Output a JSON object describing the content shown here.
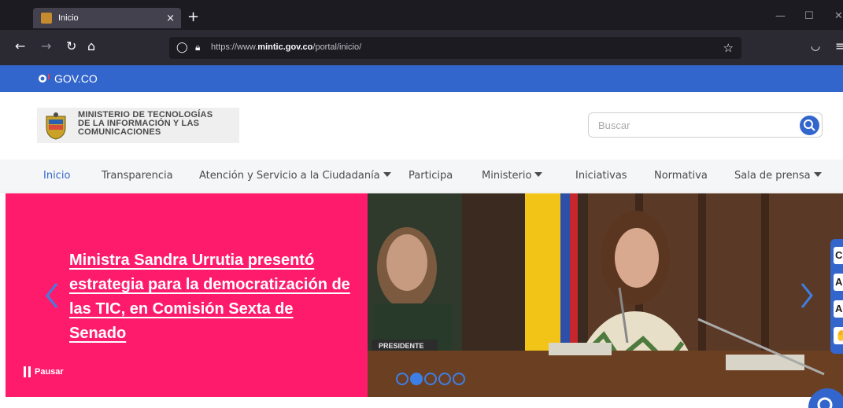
{
  "browser": {
    "tab_title": "Inicio",
    "tab_close": "×",
    "new_tab": "+",
    "url_prefix": "https://www.",
    "url_domain": "mintic.gov.co",
    "url_path": "/portal/inicio/"
  },
  "gov_bar": {
    "label": "GOV.CO"
  },
  "header": {
    "ministry_line1": "MINISTERIO DE TECNOLOGÍAS",
    "ministry_line2": "DE LA INFORMACIÓN Y LAS",
    "ministry_line3": "COMUNICACIONES",
    "search_placeholder": "Buscar"
  },
  "menu": {
    "items": [
      {
        "label": "Inicio",
        "active": true
      },
      {
        "label": "Transparencia"
      },
      {
        "label": "Atención y Servicio a la Ciudadanía",
        "dropdown": true
      },
      {
        "label": "Participa"
      },
      {
        "label": "Ministerio",
        "dropdown": true
      },
      {
        "label": "Iniciativas"
      },
      {
        "label": "Normativa"
      },
      {
        "label": "Sala de prensa",
        "dropdown": true
      }
    ]
  },
  "hero": {
    "headline": "Ministra Sandra Urrutia presentó estrategia para la democratización de las TIC, en Comisión Sexta de Senado",
    "pause_label": "Pausar",
    "placard_text": "PRESIDENTE",
    "slides_total": 5,
    "active_slide": 2
  },
  "accessibility": {
    "buttons": [
      "C",
      "A",
      "A",
      "✋"
    ]
  },
  "colors": {
    "brand_blue": "#3366cc",
    "hero_pink": "#ff1b6b",
    "browser_dark": "#1c1b22"
  }
}
